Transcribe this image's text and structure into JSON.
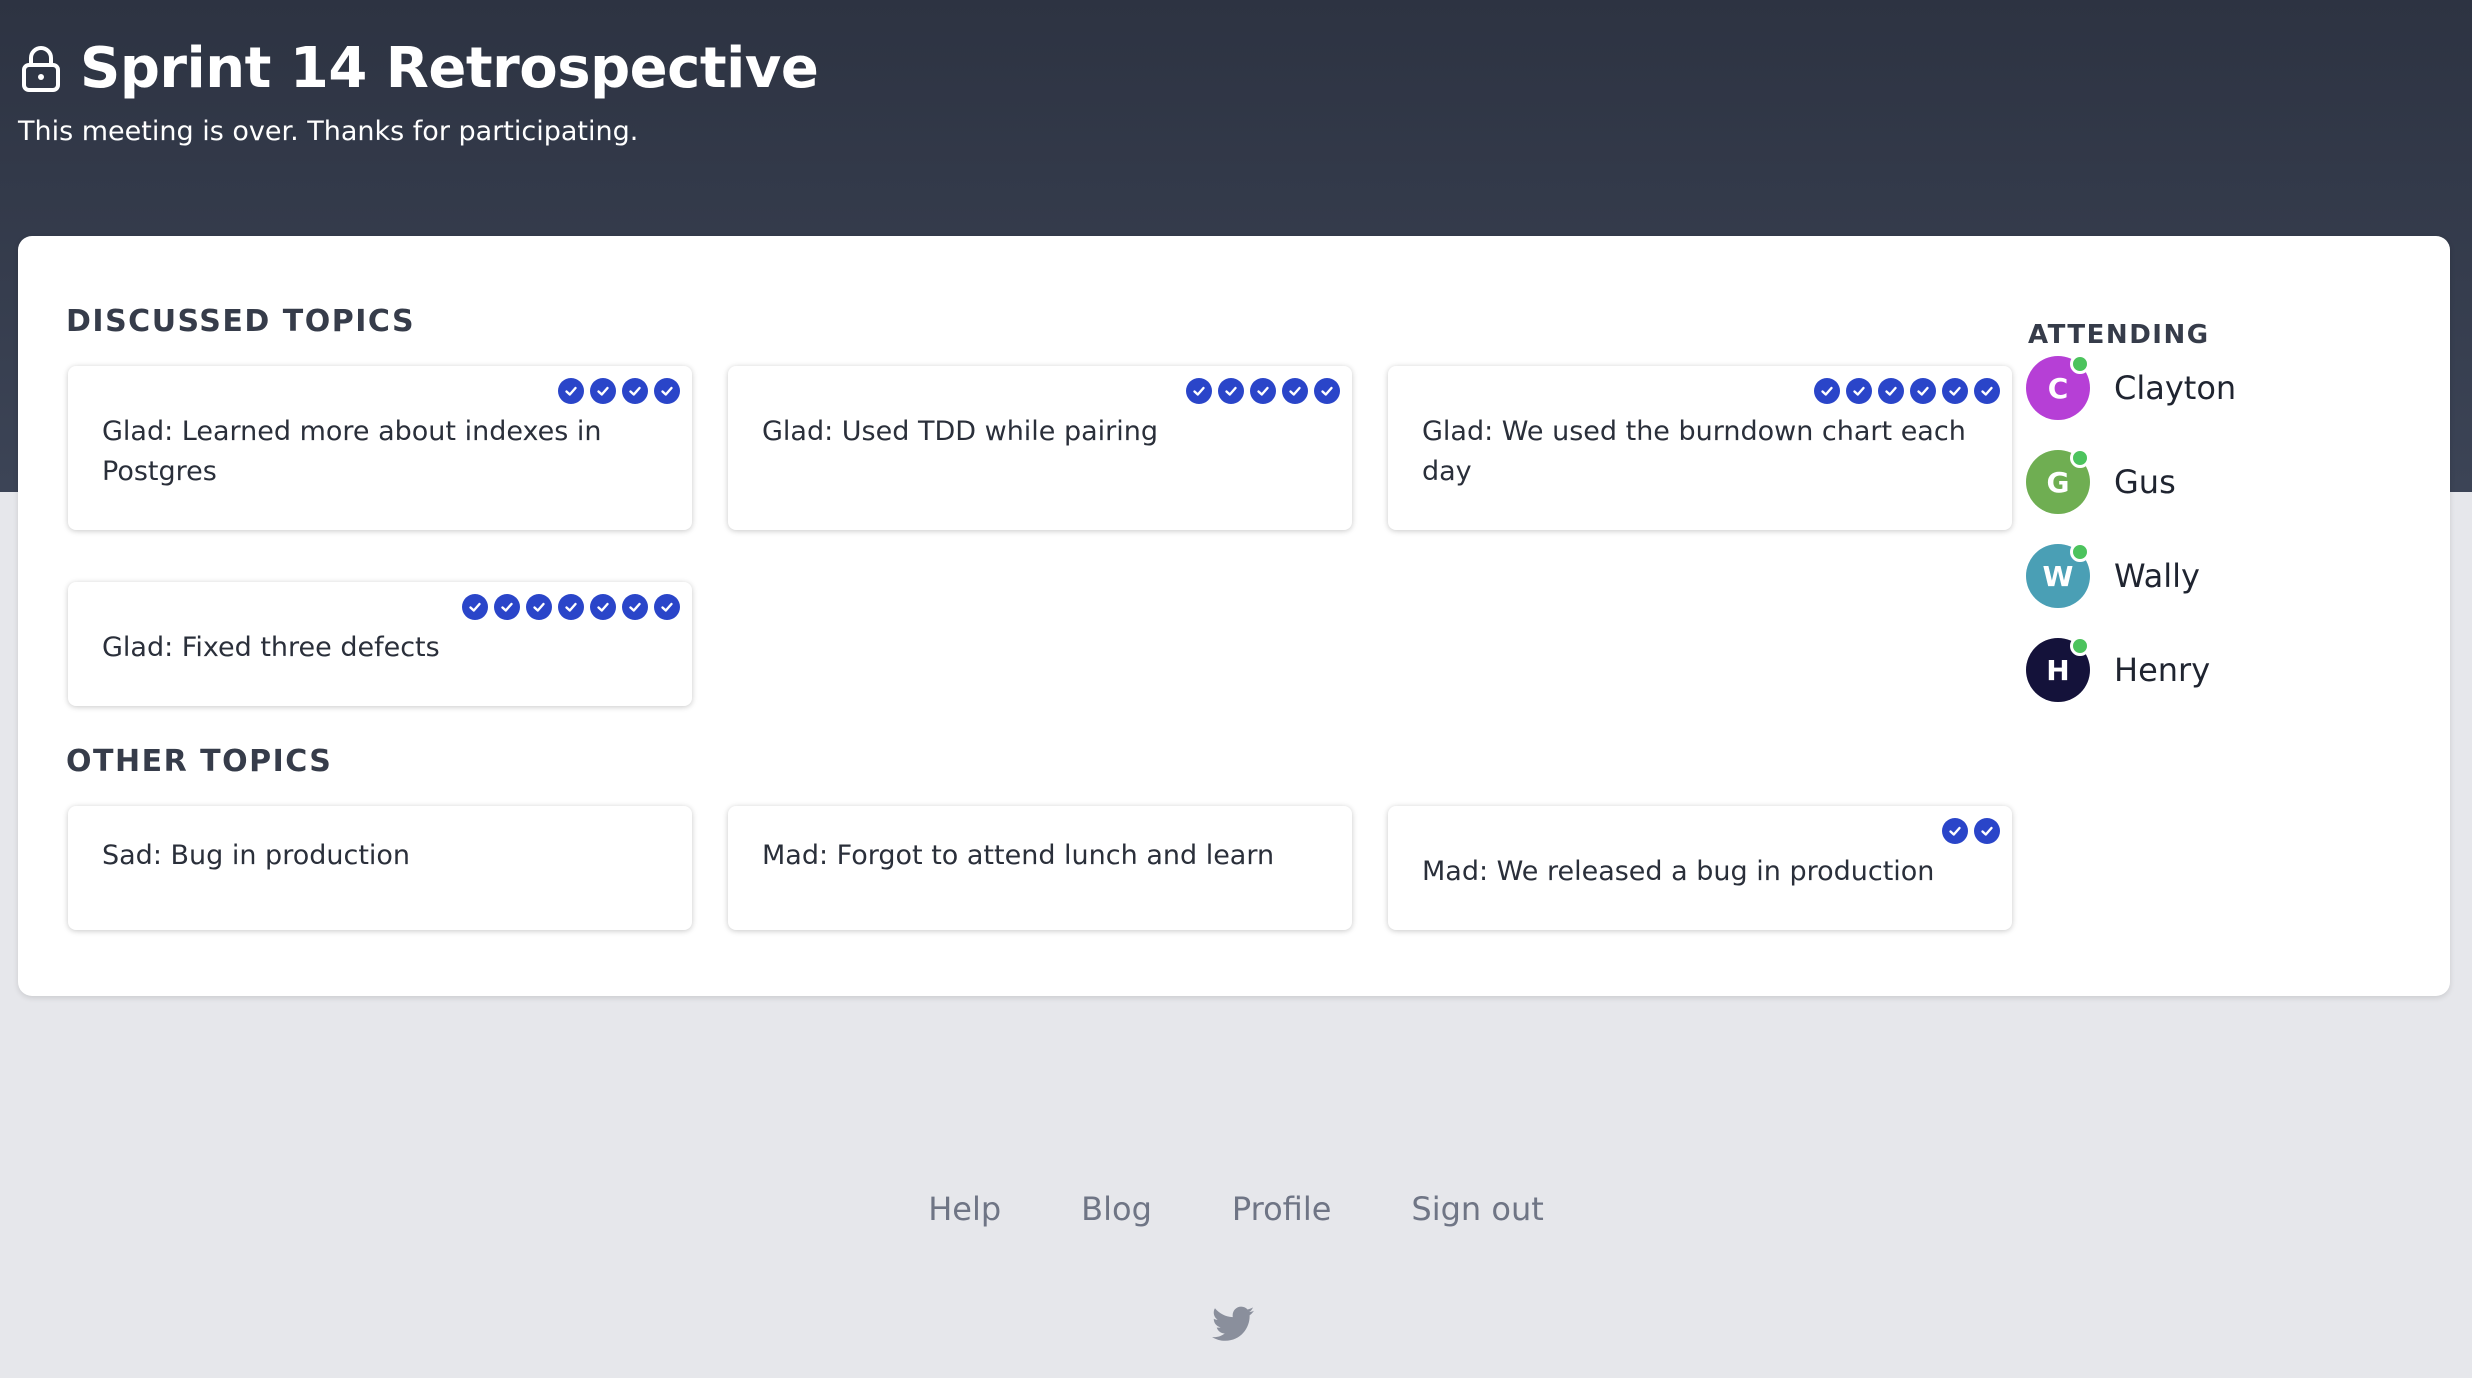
{
  "header": {
    "title": "Sprint 14 Retrospective",
    "subtitle": "This meeting is over. Thanks for participating."
  },
  "discussed": {
    "heading": "DISCUSSED TOPICS",
    "topics": [
      {
        "text": "Glad: Learned more about indexes in Postgres",
        "votes": 4
      },
      {
        "text": "Glad: Used TDD while pairing",
        "votes": 5
      },
      {
        "text": "Glad: We used the burndown chart each day",
        "votes": 6
      },
      {
        "text": "Glad: Fixed three defects",
        "votes": 7
      }
    ]
  },
  "other": {
    "heading": "OTHER TOPICS",
    "topics": [
      {
        "text": "Sad: Bug in production",
        "votes": 0
      },
      {
        "text": "Mad: Forgot to attend lunch and learn",
        "votes": 0
      },
      {
        "text": "Mad: We released a bug in production",
        "votes": 2
      }
    ]
  },
  "attending": {
    "heading": "ATTENDING",
    "people": [
      {
        "initial": "C",
        "name": "Clayton",
        "color": "#b63fd6"
      },
      {
        "initial": "G",
        "name": "Gus",
        "color": "#6fae52"
      },
      {
        "initial": "W",
        "name": "Wally",
        "color": "#4a9fb5"
      },
      {
        "initial": "H",
        "name": "Henry",
        "color": "#14123a"
      }
    ]
  },
  "footer": {
    "links": [
      "Help",
      "Blog",
      "Profile",
      "Sign out"
    ]
  },
  "colors": {
    "vote": "#2a45c9",
    "online": "#4cc35d"
  },
  "icons": {
    "lock": "lock-icon",
    "vote": "checkmark-circle-icon",
    "twitter": "twitter-icon"
  }
}
